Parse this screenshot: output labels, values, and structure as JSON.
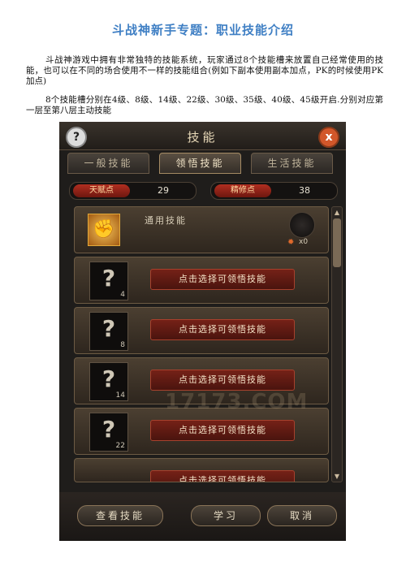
{
  "document": {
    "title": "斗战神新手专题：职业技能介绍",
    "paragraph1": "斗战神游戏中拥有非常独特的技能系统，玩家通过8个技能槽来放置自己经常使用的技能，也可以在不同的场合使用不一样的技能组合(例如下副本使用副本加点，PK的时候使用PK加点)",
    "paragraph2": "8个技能槽分别在4级、8级、14级、22级、30级、35级、40级、45级开启.分别对应第一层至第八层主动技能"
  },
  "game_panel": {
    "title": "技能",
    "help_icon": "?",
    "close_icon": "x",
    "tabs": [
      {
        "label": "一般技能"
      },
      {
        "label": "领悟技能",
        "active": true
      },
      {
        "label": "生活技能"
      }
    ],
    "stats": {
      "talent_label": "天赋点",
      "talent_value": "29",
      "refine_label": "精修点",
      "refine_value": "38"
    },
    "general_skill": {
      "icon": "fist-icon",
      "label": "通用技能",
      "count": "x0"
    },
    "slots": [
      {
        "symbol": "?",
        "level": "4",
        "button": "点击选择可领悟技能"
      },
      {
        "symbol": "?",
        "level": "8",
        "button": "点击选择可领悟技能"
      },
      {
        "symbol": "?",
        "level": "14",
        "button": "点击选择可领悟技能"
      },
      {
        "symbol": "?",
        "level": "22",
        "button": "点击选择可领悟技能"
      },
      {
        "symbol": "?",
        "level": "",
        "button": "点击选择可领悟技能"
      }
    ],
    "watermark": "17173.COM",
    "footer": {
      "view_skills": "查看技能",
      "learn": "学习",
      "cancel": "取消"
    }
  }
}
